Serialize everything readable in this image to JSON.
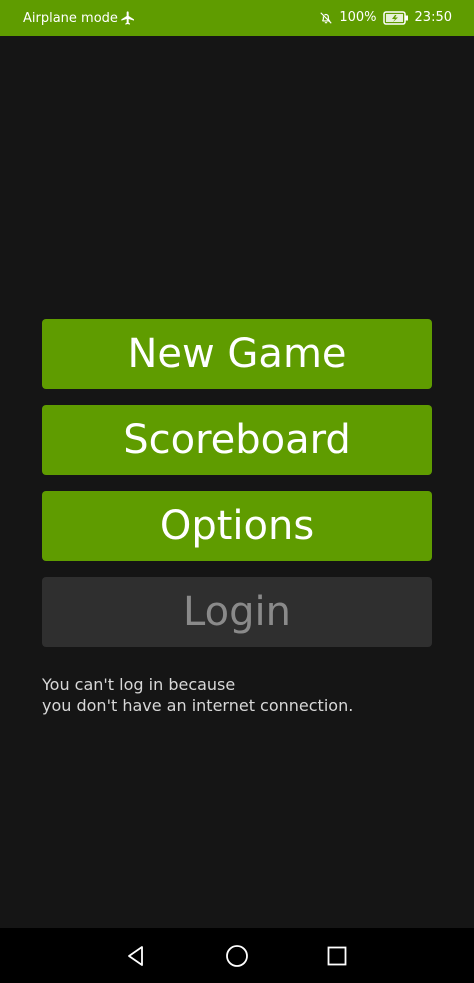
{
  "status_bar": {
    "left_text": "Airplane mode",
    "battery": "100%",
    "time": "23:50",
    "icons": [
      "airplane-icon",
      "bell-off-icon",
      "battery-icon"
    ]
  },
  "menu": {
    "new_game": "New Game",
    "scoreboard": "Scoreboard",
    "options": "Options",
    "login": "Login"
  },
  "notice": {
    "line1": "You can't log in because",
    "line2": "you don't have an internet connection."
  },
  "nav_bar": {
    "icons": [
      "back-icon",
      "home-icon",
      "recent-apps-icon"
    ]
  },
  "colors": {
    "accent": "#5f9c00",
    "background": "#151515",
    "disabled": "#2f2f2f"
  }
}
